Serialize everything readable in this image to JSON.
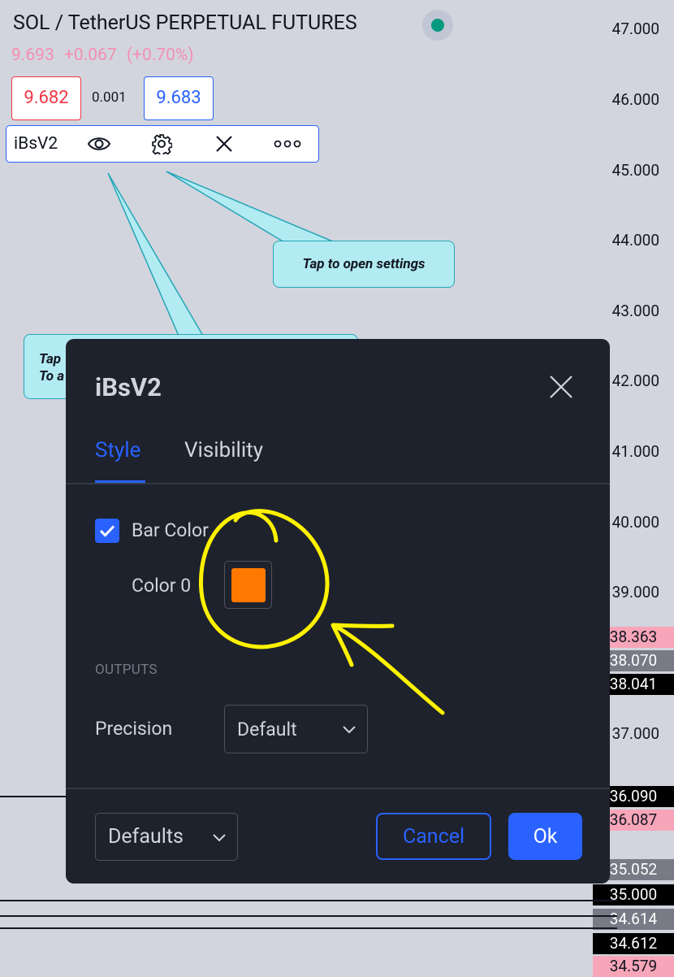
{
  "header": {
    "symbol": "SOL / TetherUS PERPETUAL FUTURES",
    "last_price": "9.693",
    "change": "+0.067",
    "change_pct": "(+0.70%)",
    "bid": "9.682",
    "spread": "0.001",
    "ask": "9.683"
  },
  "legend": {
    "indicator_name": "iBsV2",
    "icons": [
      "eye-icon",
      "gear-icon",
      "close-icon",
      "more-dots-icon"
    ]
  },
  "price_axis": {
    "ticks": [
      "47.000",
      "46.000",
      "45.000",
      "44.000",
      "43.000",
      "42.000",
      "41.000",
      "40.000",
      "39.000",
      "37.000"
    ],
    "badges": [
      {
        "label": "38.363",
        "bg": "#f7a5b8",
        "fg": "#131722"
      },
      {
        "label": "38.070",
        "bg": "#787b86",
        "fg": "#ffffff"
      },
      {
        "label": "38.041",
        "bg": "#000000",
        "fg": "#ffffff"
      },
      {
        "label": "36.090",
        "bg": "#000000",
        "fg": "#ffffff"
      },
      {
        "label": "36.087",
        "bg": "#f7a5b8",
        "fg": "#131722"
      },
      {
        "label": "35.052",
        "bg": "#787b86",
        "fg": "#ffffff"
      },
      {
        "label": "35.000",
        "bg": "#000000",
        "fg": "#ffffff"
      },
      {
        "label": "34.614",
        "bg": "#787b86",
        "fg": "#ffffff"
      },
      {
        "label": "34.612",
        "bg": "#000000",
        "fg": "#ffffff"
      },
      {
        "label": "34.579",
        "bg": "#f7a5b8",
        "fg": "#131722"
      }
    ]
  },
  "tooltips": {
    "settings": "Tap to open settings",
    "visibility_line1": "Tap",
    "visibility_line2": "To a"
  },
  "dialog": {
    "title": "iBsV2",
    "tabs": [
      {
        "label": "Style",
        "active": true
      },
      {
        "label": "Visibility",
        "active": false
      }
    ],
    "bar_color_label": "Bar Color",
    "bar_color_checked": true,
    "color_label": "Color 0",
    "color_value": "#ff7800",
    "outputs_header": "OUTPUTS",
    "precision_label": "Precision",
    "precision_value": "Default",
    "defaults_label": "Defaults",
    "cancel_label": "Cancel",
    "ok_label": "Ok"
  },
  "colors": {
    "accent": "#2962ff",
    "dialog_bg": "#1e222d",
    "up": "#f23645",
    "annotation": "#fff200"
  }
}
